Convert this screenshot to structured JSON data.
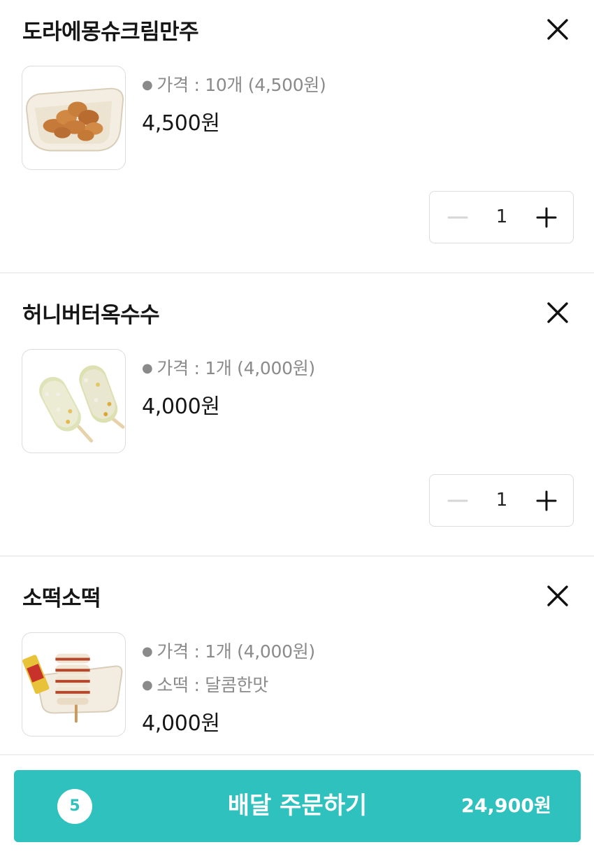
{
  "cart": {
    "items": [
      {
        "name": "도라에몽슈크림만주",
        "options": [
          "가격 : 10개 (4,500원)"
        ],
        "price": "4,500원",
        "quantity": "1"
      },
      {
        "name": "허니버터옥수수",
        "options": [
          "가격 : 1개 (4,000원)"
        ],
        "price": "4,000원",
        "quantity": "1"
      },
      {
        "name": "소떡소떡",
        "options": [
          "가격 : 1개 (4,000원)",
          "소떡 : 달콤한맛"
        ],
        "price": "4,000원"
      }
    ]
  },
  "order_bar": {
    "count": "5",
    "label": "배달 주문하기",
    "total": "24,900원",
    "color": "#2ec1bd"
  },
  "icons": {
    "remove": "close-icon",
    "decrease": "minus-icon",
    "increase": "plus-icon"
  }
}
